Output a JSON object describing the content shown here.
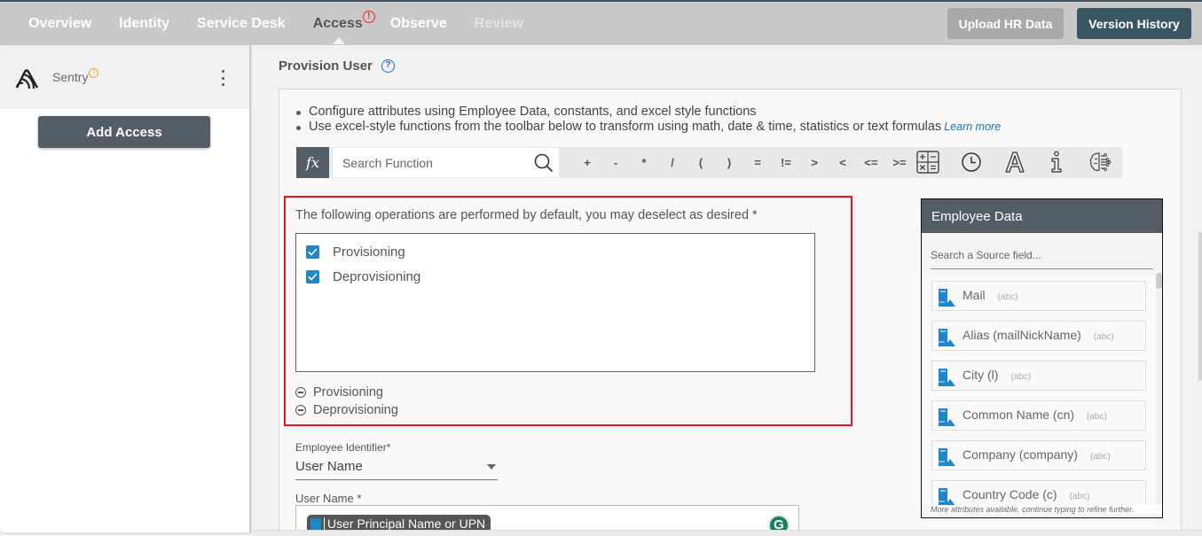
{
  "topnav": {
    "tabs": [
      {
        "label": "Overview",
        "state": "normal"
      },
      {
        "label": "Identity",
        "state": "normal"
      },
      {
        "label": "Service Desk",
        "state": "normal"
      },
      {
        "label": "Access",
        "state": "active",
        "alert": "!"
      },
      {
        "label": "Observe",
        "state": "normal"
      },
      {
        "label": "Review",
        "state": "disabled"
      }
    ],
    "upload_label": "Upload HR Data",
    "version_label": "Version History"
  },
  "sidebar": {
    "app_name": "Sentry",
    "app_alert": "!",
    "add_access_label": "Add Access"
  },
  "main": {
    "title": "Provision User",
    "help": "?",
    "bullets": [
      "Configure attributes using Employee Data, constants, and excel style functions",
      "Use excel-style functions from the toolbar below to transform using math, date & time, statistics or text formulas"
    ],
    "learn_more": "Learn more",
    "toolbar": {
      "fx": "fx",
      "search_placeholder": "Search Function",
      "operators": [
        "+",
        "-",
        "*",
        "/",
        "(",
        ")",
        "=",
        "!=",
        ">",
        "<",
        "<=",
        ">="
      ],
      "icons": [
        "math-icon",
        "clock-icon",
        "text-icon",
        "info-icon",
        "ai-brain-icon"
      ]
    },
    "operations": {
      "description": "The following operations are performed by default, you may deselect as desired *",
      "checkboxes": [
        {
          "label": "Provisioning",
          "checked": true
        },
        {
          "label": "Deprovisioning",
          "checked": true
        }
      ],
      "collapsibles": [
        "Provisioning",
        "Deprovisioning"
      ]
    },
    "employee_identifier": {
      "label": "Employee Identifier*",
      "value": "User Name"
    },
    "user_name": {
      "label": "User Name *",
      "chip": "User Principal Name or UPN",
      "grammarly": "G"
    }
  },
  "employee_data": {
    "title": "Employee Data",
    "search_placeholder": "Search a Source field...",
    "items": [
      {
        "name": "Mail",
        "type": "(abc)"
      },
      {
        "name": "Alias (mailNickName)",
        "type": "(abc)"
      },
      {
        "name": "City (l)",
        "type": "(abc)"
      },
      {
        "name": "Common Name (cn)",
        "type": "(abc)"
      },
      {
        "name": "Company (company)",
        "type": "(abc)"
      },
      {
        "name": "Country Code (c)",
        "type": "(abc)"
      }
    ],
    "more_note": "More attributes available, continue typing to refine further."
  },
  "colors": {
    "accent_blue": "#1f86c8",
    "highlight_red": "#e0161e",
    "dark_slate": "#525d66",
    "version_btn": "#3b5663"
  }
}
